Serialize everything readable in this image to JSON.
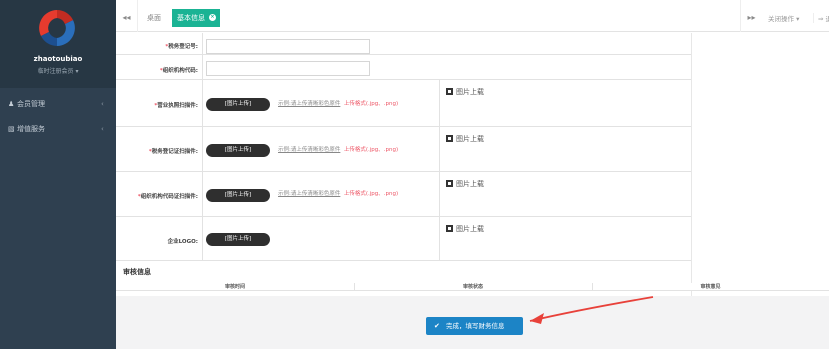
{
  "sidebar": {
    "logo": "brand-logo",
    "user_name": "zhaotoubiao",
    "user_role": "临时注册会员 ▾",
    "items": [
      {
        "label": "会员管理",
        "icon": "user-icon",
        "arrow": "‹"
      },
      {
        "label": "增值服务",
        "icon": "book-icon",
        "arrow": "‹"
      }
    ]
  },
  "tabbar": {
    "nav_left": "◂◂",
    "tabs": [
      {
        "label": "桌面"
      },
      {
        "label": "基本信息",
        "close": "×"
      }
    ],
    "nav_right": "▸▸",
    "close_ops": "关闭操作 ▾",
    "exit": "⇒ 退出"
  },
  "form": {
    "tax_reg_label": "税务登记号:",
    "org_code_label": "组织机构代码:",
    "license_label": "营业执照扫描件:",
    "tax_cert_label": "税务登记证扫描件:",
    "org_cert_label": "组织机构代码证扫描件:",
    "logo_label": "企业LOGO:",
    "required_mark": "*",
    "upload_label": "[图片上传]",
    "hint_example": "示例:请上传清晰彩色原件",
    "hint_format": "上传格式(.jpg、.png)",
    "preview_label": "图片上载"
  },
  "audit": {
    "title": "审核信息",
    "columns": [
      "审核时间",
      "审核状态",
      "审核意见"
    ]
  },
  "submit": {
    "icon": "✔",
    "label": "完成，填写财务信息"
  },
  "colors": {
    "sidebar": "#2f4050",
    "accent": "#1ab394",
    "primary": "#1c84c6",
    "required": "#ed5565",
    "annotation_arrow": "#e8413a"
  }
}
